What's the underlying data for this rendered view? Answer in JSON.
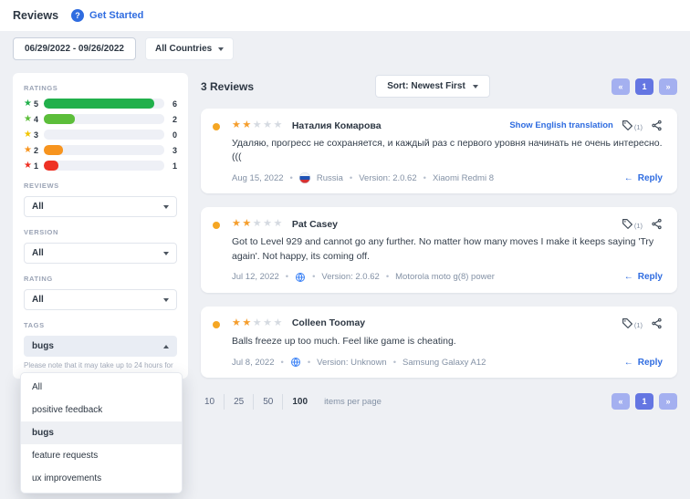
{
  "accent_color": "#2f6ce0",
  "header": {
    "title": "Reviews",
    "get_started": "Get Started"
  },
  "toolbar": {
    "date_range": "06/29/2022 - 09/26/2022",
    "countries_label": "All Countries"
  },
  "sidebar": {
    "ratings_label": "RATINGS",
    "ratings": [
      {
        "star": "★",
        "level": "5",
        "count": "6",
        "color": "#21b04b",
        "pct": 92
      },
      {
        "star": "★",
        "level": "4",
        "count": "2",
        "color": "#5cbe3a",
        "pct": 26
      },
      {
        "star": "★",
        "level": "3",
        "count": "0",
        "color": "#f2c500",
        "pct": 0
      },
      {
        "star": "★",
        "level": "2",
        "count": "3",
        "color": "#f7941e",
        "pct": 16
      },
      {
        "star": "★",
        "level": "1",
        "count": "1",
        "color": "#ee3124",
        "pct": 12
      }
    ],
    "filters": [
      {
        "label": "REVIEWS",
        "value": "All"
      },
      {
        "label": "VERSION",
        "value": "All"
      },
      {
        "label": "RATING",
        "value": "All"
      }
    ],
    "tags": {
      "label": "TAGS",
      "value": "bugs"
    },
    "note": "Please note that it may take up to 24 hours for",
    "dropdown": {
      "items": [
        "All",
        "positive feedback",
        "bugs",
        "feature requests",
        "ux improvements"
      ],
      "selected": "bugs"
    }
  },
  "main": {
    "count_label": "3 Reviews",
    "sort_label": "Sort: Newest First",
    "pager": {
      "prev": "«",
      "page": "1",
      "next": "»"
    },
    "reviews": [
      {
        "author": "Наталия Комарова",
        "stars_filled": "★★",
        "stars_empty": "★★★",
        "translate_link": "Show English translation",
        "tag_count": "(1)",
        "text": "Удаляю, прогресс не сохраняется, и каждый раз с первого уровня начинать не очень интересно.(((",
        "date": "Aug 15, 2022",
        "country": "Russia",
        "version": "Version: 2.0.62",
        "device": "Xiaomi Redmi 8",
        "reply_label": "Reply"
      },
      {
        "author": "Pat Casey",
        "stars_filled": "★★",
        "stars_empty": "★★★",
        "tag_count": "(1)",
        "text": "Got to Level 929 and cannot go any further. No matter how many moves I make it keeps saying 'Try again'. Not happy, its coming off.",
        "date": "Jul 12, 2022",
        "version": "Version: 2.0.62",
        "device": "Motorola moto g(8) power",
        "reply_label": "Reply"
      },
      {
        "author": "Colleen Toomay",
        "stars_filled": "★★",
        "stars_empty": "★★★",
        "tag_count": "(1)",
        "text": "Balls freeze up too much. Feel like game is cheating.",
        "date": "Jul 8, 2022",
        "version": "Version: Unknown",
        "device": "Samsung Galaxy A12",
        "reply_label": "Reply"
      }
    ],
    "per_page": {
      "options": [
        "10",
        "25",
        "50",
        "100"
      ],
      "selected": "100",
      "label": "items per page"
    }
  }
}
